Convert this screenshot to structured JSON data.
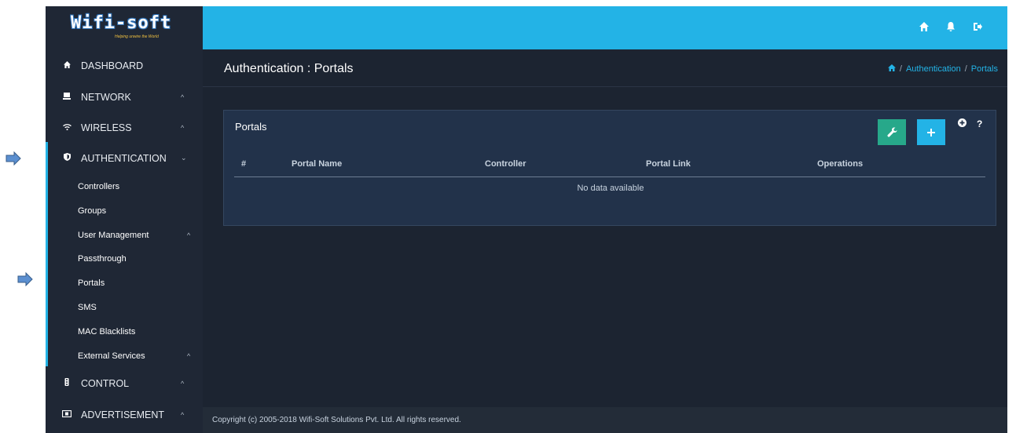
{
  "brand": {
    "logo_text": "Wifi-soft",
    "tagline": "Helping unwire the World"
  },
  "topbar": {
    "icons": [
      "home-icon",
      "bell-icon",
      "logout-icon"
    ]
  },
  "sidebar": {
    "items": [
      {
        "label": "DASHBOARD",
        "icon": "home-icon",
        "expanded": false
      },
      {
        "label": "NETWORK",
        "icon": "monitor-icon",
        "chevron": "^"
      },
      {
        "label": "WIRELESS",
        "icon": "wifi-icon",
        "chevron": "^"
      },
      {
        "label": "AUTHENTICATION",
        "icon": "shield-icon",
        "chevron": "⌄"
      },
      {
        "label": "CONTROL",
        "icon": "traffic-light-icon",
        "chevron": "^"
      },
      {
        "label": "ADVERTISEMENT",
        "icon": "ad-icon",
        "chevron": "^"
      }
    ],
    "sub_items": [
      {
        "label": "Controllers"
      },
      {
        "label": "Groups"
      },
      {
        "label": "User Management",
        "chevron": "^"
      },
      {
        "label": "Passthrough"
      },
      {
        "label": "Portals"
      },
      {
        "label": "SMS"
      },
      {
        "label": "MAC Blacklists"
      },
      {
        "label": "External Services",
        "chevron": "^"
      }
    ]
  },
  "header": {
    "title": "Authentication : Portals",
    "breadcrumb": [
      "Authentication",
      "Portals"
    ],
    "separator": "/"
  },
  "panel": {
    "title": "Portals",
    "columns": [
      "#",
      "Portal Name",
      "Controller",
      "Portal Link",
      "Operations"
    ],
    "empty_text": "No data available",
    "help_label": "?"
  },
  "footer": {
    "copyright": "Copyright (c) 2005-2018 Wifi-Soft Solutions Pvt. Ltd. All rights reserved."
  },
  "colors": {
    "accent": "#23b3e6",
    "sidebar_bg": "#1f2735",
    "content_bg": "#1c2431",
    "panel_bg": "#22324a",
    "tools_button": "#27a88a",
    "annotation_arrow": "#4f81bd"
  }
}
